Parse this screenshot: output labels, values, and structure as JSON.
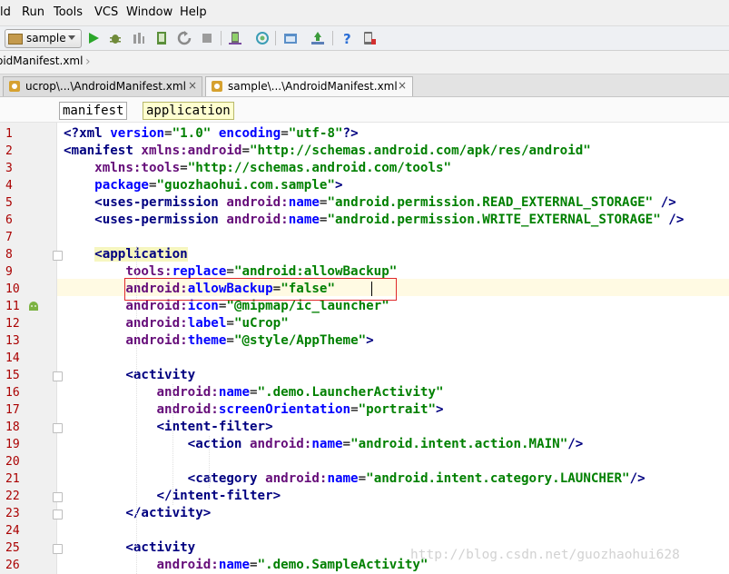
{
  "menu": [
    {
      "id": "build",
      "label": "ld"
    },
    {
      "id": "run",
      "label": "Run"
    },
    {
      "id": "tools",
      "label": "Tools"
    },
    {
      "id": "vcs",
      "label": "VCS"
    },
    {
      "id": "window",
      "label": "Window"
    },
    {
      "id": "help",
      "label": "Help"
    }
  ],
  "toolbar": {
    "run_config": "sample",
    "icons": [
      "run-icon",
      "debug-icon",
      "attach-debugger-icon",
      "apply-changes-icon",
      "rerun-icon",
      "stop-icon",
      "avd-manager-icon",
      "sync-project-icon",
      "project-structure-icon",
      "sdk-manager-icon",
      "help-icon",
      "device-monitor-icon"
    ]
  },
  "navbar": {
    "crumb": "oidManifest.xml"
  },
  "tabs": [
    {
      "label": "ucrop\\...\\AndroidManifest.xml",
      "close": "×",
      "active": false
    },
    {
      "label": "sample\\...\\AndroidManifest.xml",
      "close": "×",
      "active": true
    }
  ],
  "breadcrumbs": [
    "manifest",
    "application"
  ],
  "editor": {
    "current_line": 10,
    "line_numbers": [
      "1",
      "2",
      "3",
      "4",
      "5",
      "6",
      "7",
      "8",
      "9",
      "10",
      "11",
      "12",
      "13",
      "14",
      "15",
      "16",
      "17",
      "18",
      "19",
      "20",
      "21",
      "22",
      "23",
      "24",
      "25",
      "26"
    ]
  },
  "code": [
    [
      [
        "pi",
        "<?xml "
      ],
      [
        "attr",
        "version"
      ],
      [
        "pun",
        "="
      ],
      [
        "val",
        "\"1.0\""
      ],
      [
        "pun",
        " "
      ],
      [
        "attr",
        "encoding"
      ],
      [
        "pun",
        "="
      ],
      [
        "val",
        "\"utf-8\""
      ],
      [
        "pi",
        "?>"
      ]
    ],
    [
      [
        "tag",
        "<manifest "
      ],
      [
        "ns",
        "xmlns:android"
      ],
      [
        "pun",
        "="
      ],
      [
        "val",
        "\"http://schemas.android.com/apk/res/android\""
      ]
    ],
    [
      [
        "pun",
        "    "
      ],
      [
        "ns",
        "xmlns:tools"
      ],
      [
        "pun",
        "="
      ],
      [
        "val",
        "\"http://schemas.android.com/tools\""
      ]
    ],
    [
      [
        "pun",
        "    "
      ],
      [
        "attr",
        "package"
      ],
      [
        "pun",
        "="
      ],
      [
        "val",
        "\"guozhaohui.com.sample\""
      ],
      [
        "tag",
        ">"
      ]
    ],
    [
      [
        "pun",
        "    "
      ],
      [
        "tag",
        "<uses-permission "
      ],
      [
        "ns",
        "android:"
      ],
      [
        "attr",
        "name"
      ],
      [
        "pun",
        "="
      ],
      [
        "val",
        "\"android.permission.READ_EXTERNAL_STORAGE\""
      ],
      [
        "tag",
        " />"
      ]
    ],
    [
      [
        "pun",
        "    "
      ],
      [
        "tag",
        "<uses-permission "
      ],
      [
        "ns",
        "android:"
      ],
      [
        "attr",
        "name"
      ],
      [
        "pun",
        "="
      ],
      [
        "val",
        "\"android.permission.WRITE_EXTERNAL_STORAGE\""
      ],
      [
        "tag",
        " />"
      ]
    ],
    [],
    [
      [
        "pun",
        "    "
      ],
      [
        "tag",
        "<application"
      ]
    ],
    [
      [
        "pun",
        "        "
      ],
      [
        "ns",
        "tools:"
      ],
      [
        "attr",
        "replace"
      ],
      [
        "pun",
        "="
      ],
      [
        "val",
        "\"android:allowBackup\""
      ]
    ],
    [
      [
        "pun",
        "        "
      ],
      [
        "ns",
        "android:"
      ],
      [
        "attr",
        "allowBackup"
      ],
      [
        "pun",
        "="
      ],
      [
        "val",
        "\"false\""
      ]
    ],
    [
      [
        "pun",
        "        "
      ],
      [
        "ns",
        "android:"
      ],
      [
        "attr",
        "icon"
      ],
      [
        "pun",
        "="
      ],
      [
        "val",
        "\"@mipmap/ic_launcher\""
      ]
    ],
    [
      [
        "pun",
        "        "
      ],
      [
        "ns",
        "android:"
      ],
      [
        "attr",
        "label"
      ],
      [
        "pun",
        "="
      ],
      [
        "val",
        "\"uCrop\""
      ]
    ],
    [
      [
        "pun",
        "        "
      ],
      [
        "ns",
        "android:"
      ],
      [
        "attr",
        "theme"
      ],
      [
        "pun",
        "="
      ],
      [
        "val",
        "\"@style/AppTheme\""
      ],
      [
        "tag",
        ">"
      ]
    ],
    [],
    [
      [
        "pun",
        "        "
      ],
      [
        "tag",
        "<activity"
      ]
    ],
    [
      [
        "pun",
        "            "
      ],
      [
        "ns",
        "android:"
      ],
      [
        "attr",
        "name"
      ],
      [
        "pun",
        "="
      ],
      [
        "val",
        "\".demo.LauncherActivity\""
      ]
    ],
    [
      [
        "pun",
        "            "
      ],
      [
        "ns",
        "android:"
      ],
      [
        "attr",
        "screenOrientation"
      ],
      [
        "pun",
        "="
      ],
      [
        "val",
        "\"portrait\""
      ],
      [
        "tag",
        ">"
      ]
    ],
    [
      [
        "pun",
        "            "
      ],
      [
        "tag",
        "<intent-filter>"
      ]
    ],
    [
      [
        "pun",
        "                "
      ],
      [
        "tag",
        "<action "
      ],
      [
        "ns",
        "android:"
      ],
      [
        "attr",
        "name"
      ],
      [
        "pun",
        "="
      ],
      [
        "val",
        "\"android.intent.action.MAIN\""
      ],
      [
        "tag",
        "/>"
      ]
    ],
    [],
    [
      [
        "pun",
        "                "
      ],
      [
        "tag",
        "<category "
      ],
      [
        "ns",
        "android:"
      ],
      [
        "attr",
        "name"
      ],
      [
        "pun",
        "="
      ],
      [
        "val",
        "\"android.intent.category.LAUNCHER\""
      ],
      [
        "tag",
        "/>"
      ]
    ],
    [
      [
        "pun",
        "            "
      ],
      [
        "tag",
        "</intent-filter>"
      ]
    ],
    [
      [
        "pun",
        "        "
      ],
      [
        "tag",
        "</activity>"
      ]
    ],
    [],
    [
      [
        "pun",
        "        "
      ],
      [
        "tag",
        "<activity"
      ]
    ],
    [
      [
        "pun",
        "            "
      ],
      [
        "ns",
        "android:"
      ],
      [
        "attr",
        "name"
      ],
      [
        "pun",
        "="
      ],
      [
        "val",
        "\".demo.SampleActivity\""
      ]
    ]
  ],
  "watermark": "http://blog.csdn.net/guozhaohui628",
  "colors": {
    "tag": "#000080",
    "namespace": "#660e7a",
    "attribute": "#0000ff",
    "value": "#008000",
    "line_number": "#aa0000",
    "caret_line": "#fffae3",
    "highlight_box": "#e0282a"
  }
}
